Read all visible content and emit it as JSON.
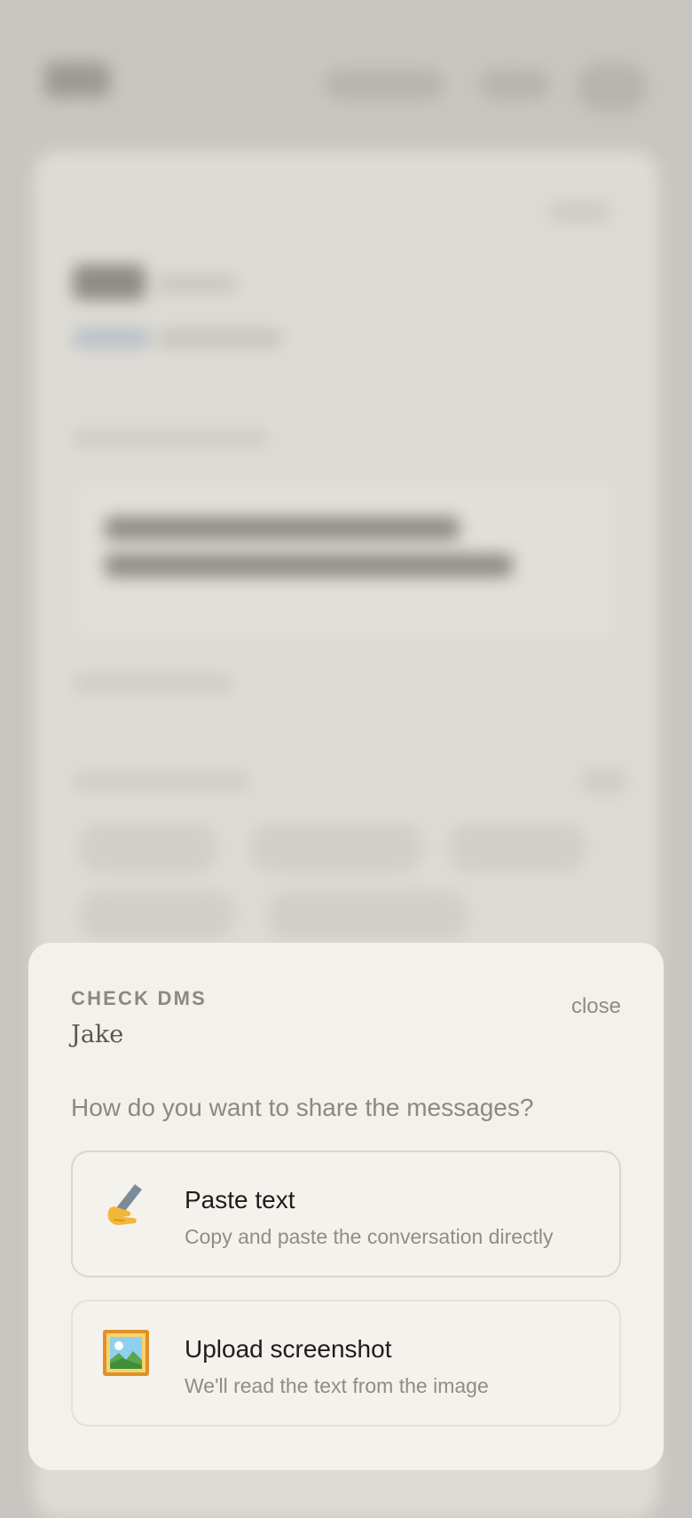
{
  "sheet": {
    "eyebrow": "CHECK DMS",
    "name": "Jake",
    "close_label": "close",
    "question": "How do you want to share the messages?",
    "options": [
      {
        "icon": "writing-hand-icon",
        "title": "Paste text",
        "description": "Copy and paste the conversation directly"
      },
      {
        "icon": "framed-picture-icon",
        "title": "Upload screenshot",
        "description": "We'll read the text from the image"
      }
    ]
  }
}
